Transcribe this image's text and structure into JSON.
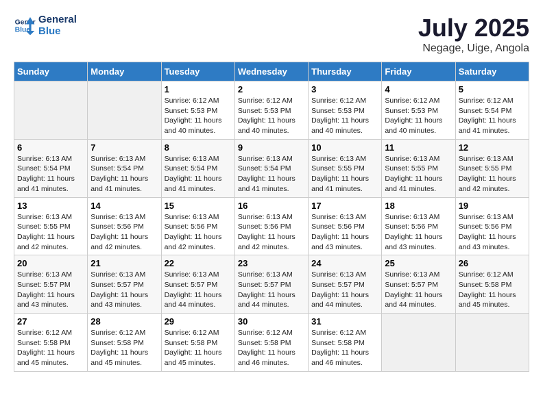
{
  "header": {
    "logo_line1": "General",
    "logo_line2": "Blue",
    "month": "July 2025",
    "location": "Negage, Uige, Angola"
  },
  "weekdays": [
    "Sunday",
    "Monday",
    "Tuesday",
    "Wednesday",
    "Thursday",
    "Friday",
    "Saturday"
  ],
  "weeks": [
    [
      {
        "day": "",
        "empty": true
      },
      {
        "day": "",
        "empty": true
      },
      {
        "day": "1",
        "sunrise": "6:12 AM",
        "sunset": "5:53 PM",
        "daylight": "11 hours and 40 minutes."
      },
      {
        "day": "2",
        "sunrise": "6:12 AM",
        "sunset": "5:53 PM",
        "daylight": "11 hours and 40 minutes."
      },
      {
        "day": "3",
        "sunrise": "6:12 AM",
        "sunset": "5:53 PM",
        "daylight": "11 hours and 40 minutes."
      },
      {
        "day": "4",
        "sunrise": "6:12 AM",
        "sunset": "5:53 PM",
        "daylight": "11 hours and 40 minutes."
      },
      {
        "day": "5",
        "sunrise": "6:12 AM",
        "sunset": "5:54 PM",
        "daylight": "11 hours and 41 minutes."
      }
    ],
    [
      {
        "day": "6",
        "sunrise": "6:13 AM",
        "sunset": "5:54 PM",
        "daylight": "11 hours and 41 minutes."
      },
      {
        "day": "7",
        "sunrise": "6:13 AM",
        "sunset": "5:54 PM",
        "daylight": "11 hours and 41 minutes."
      },
      {
        "day": "8",
        "sunrise": "6:13 AM",
        "sunset": "5:54 PM",
        "daylight": "11 hours and 41 minutes."
      },
      {
        "day": "9",
        "sunrise": "6:13 AM",
        "sunset": "5:54 PM",
        "daylight": "11 hours and 41 minutes."
      },
      {
        "day": "10",
        "sunrise": "6:13 AM",
        "sunset": "5:55 PM",
        "daylight": "11 hours and 41 minutes."
      },
      {
        "day": "11",
        "sunrise": "6:13 AM",
        "sunset": "5:55 PM",
        "daylight": "11 hours and 41 minutes."
      },
      {
        "day": "12",
        "sunrise": "6:13 AM",
        "sunset": "5:55 PM",
        "daylight": "11 hours and 42 minutes."
      }
    ],
    [
      {
        "day": "13",
        "sunrise": "6:13 AM",
        "sunset": "5:55 PM",
        "daylight": "11 hours and 42 minutes."
      },
      {
        "day": "14",
        "sunrise": "6:13 AM",
        "sunset": "5:56 PM",
        "daylight": "11 hours and 42 minutes."
      },
      {
        "day": "15",
        "sunrise": "6:13 AM",
        "sunset": "5:56 PM",
        "daylight": "11 hours and 42 minutes."
      },
      {
        "day": "16",
        "sunrise": "6:13 AM",
        "sunset": "5:56 PM",
        "daylight": "11 hours and 42 minutes."
      },
      {
        "day": "17",
        "sunrise": "6:13 AM",
        "sunset": "5:56 PM",
        "daylight": "11 hours and 43 minutes."
      },
      {
        "day": "18",
        "sunrise": "6:13 AM",
        "sunset": "5:56 PM",
        "daylight": "11 hours and 43 minutes."
      },
      {
        "day": "19",
        "sunrise": "6:13 AM",
        "sunset": "5:56 PM",
        "daylight": "11 hours and 43 minutes."
      }
    ],
    [
      {
        "day": "20",
        "sunrise": "6:13 AM",
        "sunset": "5:57 PM",
        "daylight": "11 hours and 43 minutes."
      },
      {
        "day": "21",
        "sunrise": "6:13 AM",
        "sunset": "5:57 PM",
        "daylight": "11 hours and 43 minutes."
      },
      {
        "day": "22",
        "sunrise": "6:13 AM",
        "sunset": "5:57 PM",
        "daylight": "11 hours and 44 minutes."
      },
      {
        "day": "23",
        "sunrise": "6:13 AM",
        "sunset": "5:57 PM",
        "daylight": "11 hours and 44 minutes."
      },
      {
        "day": "24",
        "sunrise": "6:13 AM",
        "sunset": "5:57 PM",
        "daylight": "11 hours and 44 minutes."
      },
      {
        "day": "25",
        "sunrise": "6:13 AM",
        "sunset": "5:57 PM",
        "daylight": "11 hours and 44 minutes."
      },
      {
        "day": "26",
        "sunrise": "6:12 AM",
        "sunset": "5:58 PM",
        "daylight": "11 hours and 45 minutes."
      }
    ],
    [
      {
        "day": "27",
        "sunrise": "6:12 AM",
        "sunset": "5:58 PM",
        "daylight": "11 hours and 45 minutes."
      },
      {
        "day": "28",
        "sunrise": "6:12 AM",
        "sunset": "5:58 PM",
        "daylight": "11 hours and 45 minutes."
      },
      {
        "day": "29",
        "sunrise": "6:12 AM",
        "sunset": "5:58 PM",
        "daylight": "11 hours and 45 minutes."
      },
      {
        "day": "30",
        "sunrise": "6:12 AM",
        "sunset": "5:58 PM",
        "daylight": "11 hours and 46 minutes."
      },
      {
        "day": "31",
        "sunrise": "6:12 AM",
        "sunset": "5:58 PM",
        "daylight": "11 hours and 46 minutes."
      },
      {
        "day": "",
        "empty": true
      },
      {
        "day": "",
        "empty": true
      }
    ]
  ],
  "labels": {
    "sunrise_prefix": "Sunrise: ",
    "sunset_prefix": "Sunset: ",
    "daylight_prefix": "Daylight: "
  }
}
